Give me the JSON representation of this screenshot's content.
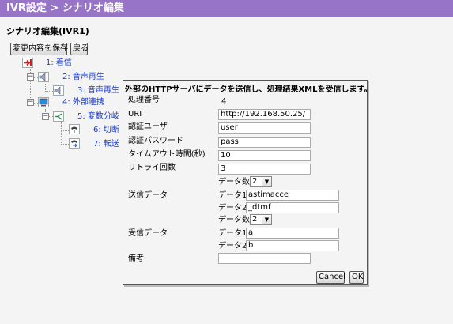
{
  "window": {
    "title": "IVR設定 > シナリオ編集"
  },
  "page": {
    "heading": "シナリオ編集(IVR1)"
  },
  "toolbar": {
    "save_label": "変更内容を保存",
    "back_label": "戻る"
  },
  "tree": {
    "nodes": [
      {
        "label": "1: 着信",
        "icon": "incoming-call-icon"
      },
      {
        "label": "2: 音声再生",
        "icon": "speaker-icon"
      },
      {
        "label": "3: 音声再生",
        "icon": "speaker-icon"
      },
      {
        "label": "4: 外部連携",
        "icon": "computer-icon"
      },
      {
        "label": "5: 変数分岐",
        "icon": "branch-icon"
      },
      {
        "label": "6: 切断",
        "icon": "hangup-icon"
      },
      {
        "label": "7: 転送",
        "icon": "transfer-icon"
      }
    ]
  },
  "dialog": {
    "header": "外部のHTTPサーバにデータを送信し、処理結果XMLを受信します。",
    "process_no": {
      "label": "処理番号",
      "value": "4"
    },
    "uri": {
      "label": "URI",
      "value": "http://192.168.50.25/"
    },
    "auth_user": {
      "label": "認証ユーザ",
      "value": "user"
    },
    "auth_password": {
      "label": "認証パスワード",
      "value": "pass"
    },
    "timeout": {
      "label": "タイムアウト時間(秒)",
      "value": "10"
    },
    "retry": {
      "label": "リトライ回数",
      "value": "3"
    },
    "send": {
      "label": "送信データ",
      "count_label": "データ数",
      "count_value": "2",
      "items": [
        {
          "label": "データ1",
          "value": "astimacce"
        },
        {
          "label": "データ2",
          "value": "_dtmf"
        }
      ]
    },
    "receive": {
      "label": "受信データ",
      "count_label": "データ数",
      "count_value": "2",
      "items": [
        {
          "label": "データ1",
          "value": "a"
        },
        {
          "label": "データ2",
          "value": "b"
        }
      ]
    },
    "remarks": {
      "label": "備考",
      "value": ""
    },
    "cancel_label": "Cancel",
    "ok_label": "OK"
  },
  "colors": {
    "titlebar": "#9874c8",
    "link": "#1a3cc8"
  }
}
